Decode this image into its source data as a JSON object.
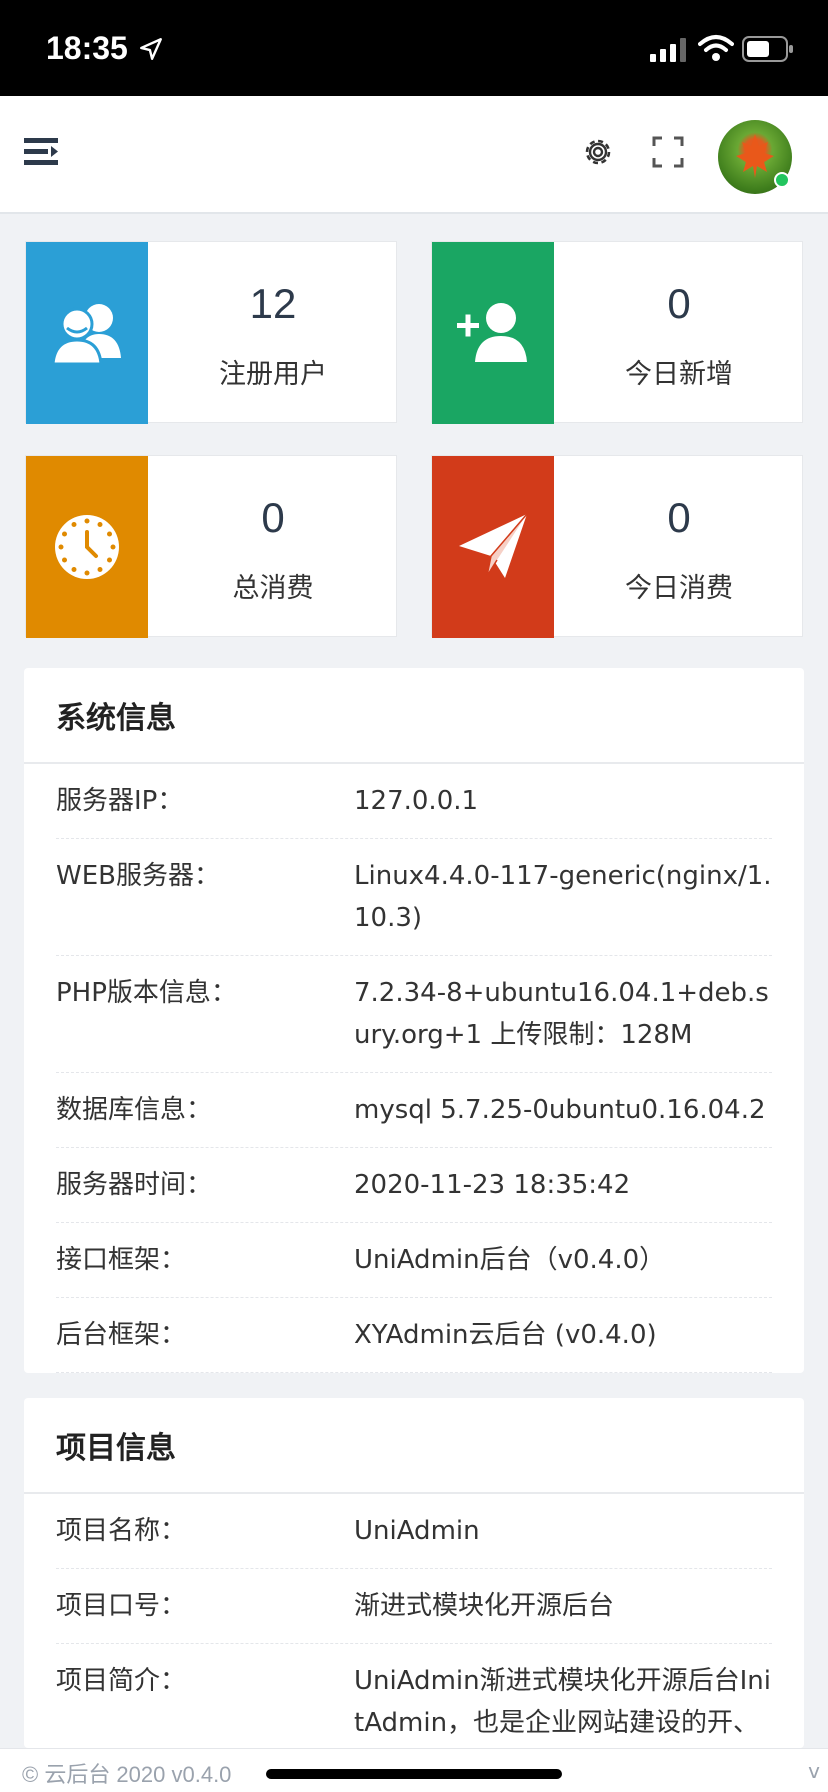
{
  "status": {
    "time": "18:35"
  },
  "stats": [
    {
      "value": "12",
      "label": "注册用户",
      "color": "#2b9fd6",
      "icon": "users-icon"
    },
    {
      "value": "0",
      "label": "今日新增",
      "color": "#1aa663",
      "icon": "add-user-icon"
    },
    {
      "value": "0",
      "label": "总消费",
      "color": "#e08a00",
      "icon": "clock-icon"
    },
    {
      "value": "0",
      "label": "今日消费",
      "color": "#d23b1a",
      "icon": "paper-plane-icon"
    }
  ],
  "system": {
    "title": "系统信息",
    "rows": [
      {
        "k": "服务器IP：",
        "v": "127.0.0.1"
      },
      {
        "k": "WEB服务器：",
        "v": "Linux4.4.0-117-generic(nginx/1.10.3)"
      },
      {
        "k": "PHP版本信息：",
        "v": "7.2.34-8+ubuntu16.04.1+deb.sury.org+1 上传限制：128M"
      },
      {
        "k": "数据库信息：",
        "v": "mysql 5.7.25-0ubuntu0.16.04.2"
      },
      {
        "k": "服务器时间：",
        "v": "2020-11-23 18:35:42"
      },
      {
        "k": "接口框架：",
        "v": "UniAdmin后台（v0.4.0）"
      },
      {
        "k": "后台框架：",
        "v": "XYAdmin云后台 (v0.4.0)"
      }
    ]
  },
  "project": {
    "title": "项目信息",
    "rows": [
      {
        "k": "项目名称：",
        "v": "UniAdmin"
      },
      {
        "k": "项目口号：",
        "v": "渐进式模块化开源后台"
      },
      {
        "k": "项目简介：",
        "v": "UniAdmin渐进式模块化开源后台InitAdmin，也是企业网站建设的开、源、免、费、CMS、系、统"
      }
    ]
  },
  "footer": {
    "copyright": "© 云后台 2020 v0.4.0",
    "right": "v"
  }
}
